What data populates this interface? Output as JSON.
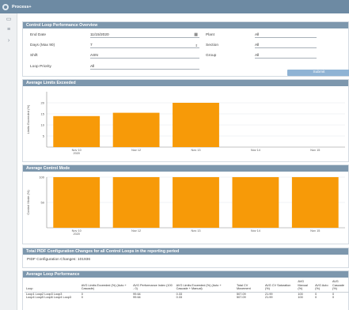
{
  "app": {
    "title": "Process+"
  },
  "rail": {
    "icons": [
      "monitor-icon",
      "menu-icon",
      "chevron-right-icon"
    ]
  },
  "overview": {
    "title": "Control Loop Performance Overview",
    "end_date_label": "End Date",
    "end_date_value": "11/15/2020",
    "days_label": "Days (Max 90)",
    "days_value": "7",
    "shift_label": "Shift",
    "shift_value": "ASN",
    "loop_priority_label": "Loop Priority",
    "loop_priority_value": "All",
    "plant_label": "Plant",
    "plant_value": "All",
    "section_label": "Section",
    "section_value": "All",
    "group_label": "Group",
    "group_value": "All",
    "submit_label": "Submit"
  },
  "limits_panel": {
    "title": "Average Limits Exceeded"
  },
  "mode_panel": {
    "title": "Average Control Mode"
  },
  "config_panel": {
    "title": "Total PIDF Configuration Changes for all Control Loops in the reporting period",
    "text": "PIDF Configuration Changes: 101936"
  },
  "loop_perf": {
    "title": "Average Loop Performance",
    "headers": [
      "Loop",
      "AVG Limits Exceeded (%) (Auto + Cascade)",
      "AVG Performance Index (100 - 0)",
      "AVG Limits Exceeded (%) (Auto + Cascade + Manual)",
      "Total CV Movement",
      "AVG CV Saturation (%)",
      "AVG Manual (%)",
      "AVG Auto (%)",
      "AVG Cascade (%)"
    ],
    "rows": [
      [
        "Loop1 Loop2 Loop3 Loop3",
        "0",
        "99.64",
        "0.33",
        "507.09",
        "21.99",
        "100",
        "0",
        "0"
      ],
      [
        "Loop4 Loop5 Loop6 Loop4 Loop3",
        "0",
        "99.64",
        "0.33",
        "507.09",
        "21.99",
        "100",
        "0",
        "0"
      ]
    ]
  },
  "chart_data": [
    {
      "type": "bar",
      "title": "Average Limits Exceeded",
      "ylabel": "Limits Exceeded (%)",
      "categories": [
        "Nov 10\n2020",
        "Nov 12",
        "Nov 13",
        "Nov 14",
        "Nov 15"
      ],
      "values": [
        14,
        15.5,
        20,
        null,
        null
      ],
      "ylim": [
        0,
        25
      ],
      "yticks": [
        5,
        10,
        15,
        20
      ],
      "grid": true,
      "color": "#f79a08"
    },
    {
      "type": "bar",
      "title": "Average Control Mode",
      "ylabel": "Control Mode (%)",
      "categories": [
        "Nov 10\n2020",
        "Nov 12",
        "Nov 13",
        "Nov 14",
        "Nov 15"
      ],
      "values": [
        100,
        100,
        100,
        100,
        100
      ],
      "ylim": [
        0,
        100
      ],
      "yticks": [
        50,
        100
      ],
      "grid": true,
      "color": "#f79a08"
    }
  ]
}
